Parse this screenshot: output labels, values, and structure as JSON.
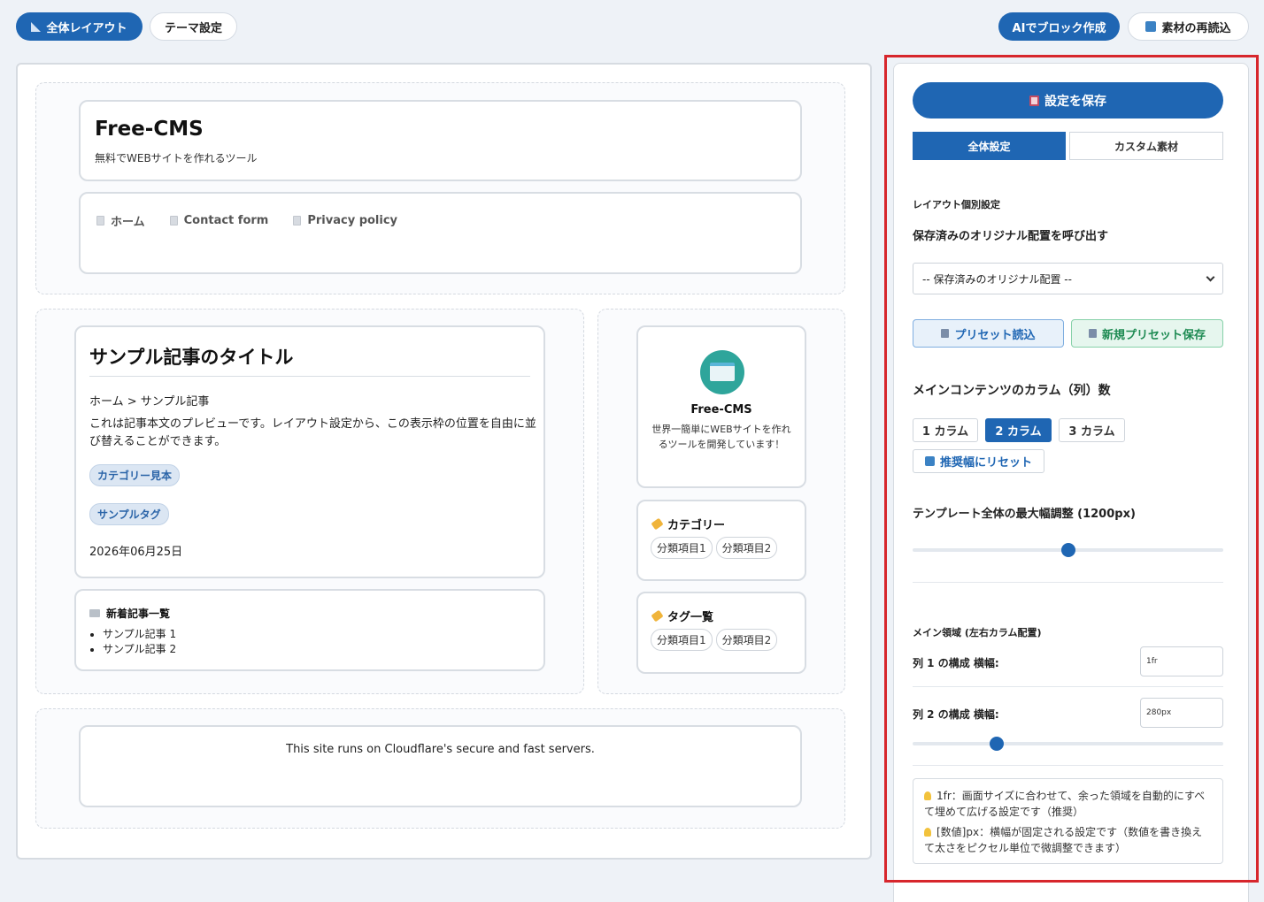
{
  "toolbar": {
    "layout_label": "全体レイアウト",
    "theme_label": "テーマ設定",
    "ai_label": "AIでブロック作成",
    "reload_label": "素材の再読込"
  },
  "site": {
    "title": "Free-CMS",
    "tagline": "無料でWEBサイトを作れるツール"
  },
  "nav": [
    "ホーム",
    "Contact form",
    "Privacy policy"
  ],
  "article": {
    "title": "サンプル記事のタイトル",
    "breadcrumb": "ホーム > サンプル記事",
    "body": "これは記事本文のプレビューです。レイアウト設定から、この表示枠の位置を自由に並び替えることができます。",
    "category": "カテゴリー見本",
    "tag": "サンプルタグ",
    "date": "2026年06月25日"
  },
  "recent": {
    "title": "新着記事一覧",
    "items": [
      "サンプル記事 1",
      "サンプル記事 2"
    ]
  },
  "profile": {
    "name": "Free-CMS",
    "desc": "世界一簡単にWEBサイトを作れるツールを開発しています！"
  },
  "sidebar_categories": {
    "title": "カテゴリー",
    "items": [
      "分類項目1",
      "分類項目2"
    ]
  },
  "sidebar_tags": {
    "title": "タグ一覧",
    "items": [
      "分類項目1",
      "分類項目2"
    ]
  },
  "footer": {
    "text": "This site runs on Cloudflare's secure and fast servers."
  },
  "settings": {
    "save_label": "設定を保存",
    "tab_global": "全体設定",
    "tab_custom": "カスタム素材",
    "layout_heading": "レイアウト個別設定",
    "saved_heading": "保存済みのオリジナル配置を呼び出す",
    "select_value": "-- 保存済みのオリジナル配置 --",
    "preset_load": "プリセット読込",
    "preset_save": "新規プリセット保存",
    "columns_heading": "メインコンテンツのカラム（列）数",
    "col1": "1 カラム",
    "col2": "2 カラム",
    "col3": "3 カラム",
    "reset_label": "推奨幅にリセット",
    "maxwidth_heading": "テンプレート全体の最大幅調整 (1200px)",
    "maxwidth_fraction": 0.5,
    "main_area_heading": "メイン領域 (左右カラム配置)",
    "col1_width_label": "列 1 の構成 横幅:",
    "col1_width_value": "1fr",
    "col2_width_label": "列 2 の構成 横幅:",
    "col2_width_value": "280px",
    "col2_slider_fraction": 0.27,
    "tip1": "1fr：画面サイズに合わせて、余った領域を自動的にすべて埋めて広げる設定です（推奨）",
    "tip2": "[数値]px：横幅が固定される設定です（数値を書き換えて太さをピクセル単位で微調整できます）"
  },
  "colors": {
    "accent": "#1f66b3",
    "highlight": "#d7262c"
  }
}
